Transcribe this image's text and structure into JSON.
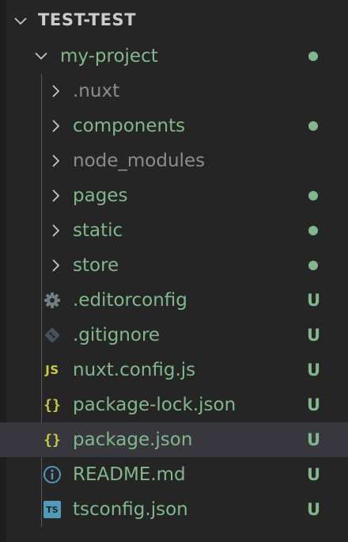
{
  "root": {
    "title": "TEST-TEST"
  },
  "project": {
    "name": "my-project"
  },
  "folders": [
    {
      "label": ".nuxt",
      "color": "#8c8c8c",
      "dot": false
    },
    {
      "label": "components",
      "color": "#81b88b",
      "dot": true
    },
    {
      "label": "node_modules",
      "color": "#8c8c8c",
      "dot": false
    },
    {
      "label": "pages",
      "color": "#81b88b",
      "dot": true
    },
    {
      "label": "static",
      "color": "#81b88b",
      "dot": true
    },
    {
      "label": "store",
      "color": "#81b88b",
      "dot": true
    }
  ],
  "files": [
    {
      "label": ".editorconfig",
      "status": "U",
      "icon": "gear-icon"
    },
    {
      "label": ".gitignore",
      "status": "U",
      "icon": "git-icon"
    },
    {
      "label": "nuxt.config.js",
      "status": "U",
      "icon": "js-file-icon",
      "icon_text": "JS"
    },
    {
      "label": "package-lock.json",
      "status": "U",
      "icon": "json-file-icon",
      "icon_text": "{}"
    },
    {
      "label": "package.json",
      "status": "U",
      "icon": "json-file-icon",
      "icon_text": "{}",
      "selected": true
    },
    {
      "label": "README.md",
      "status": "U",
      "icon": "info-icon"
    },
    {
      "label": "tsconfig.json",
      "status": "U",
      "icon": "ts-file-icon",
      "icon_text": "TS"
    }
  ],
  "colors": {
    "untracked": "#81b88b",
    "ignored": "#8c8c8c",
    "header": "#cccccc",
    "js": "#cbcb41",
    "json": "#cbcb41",
    "info": "#519aba",
    "ts": "#519aba",
    "gear": "#6d8086",
    "git": "#41535b",
    "chevron": "#c5c5c5"
  }
}
